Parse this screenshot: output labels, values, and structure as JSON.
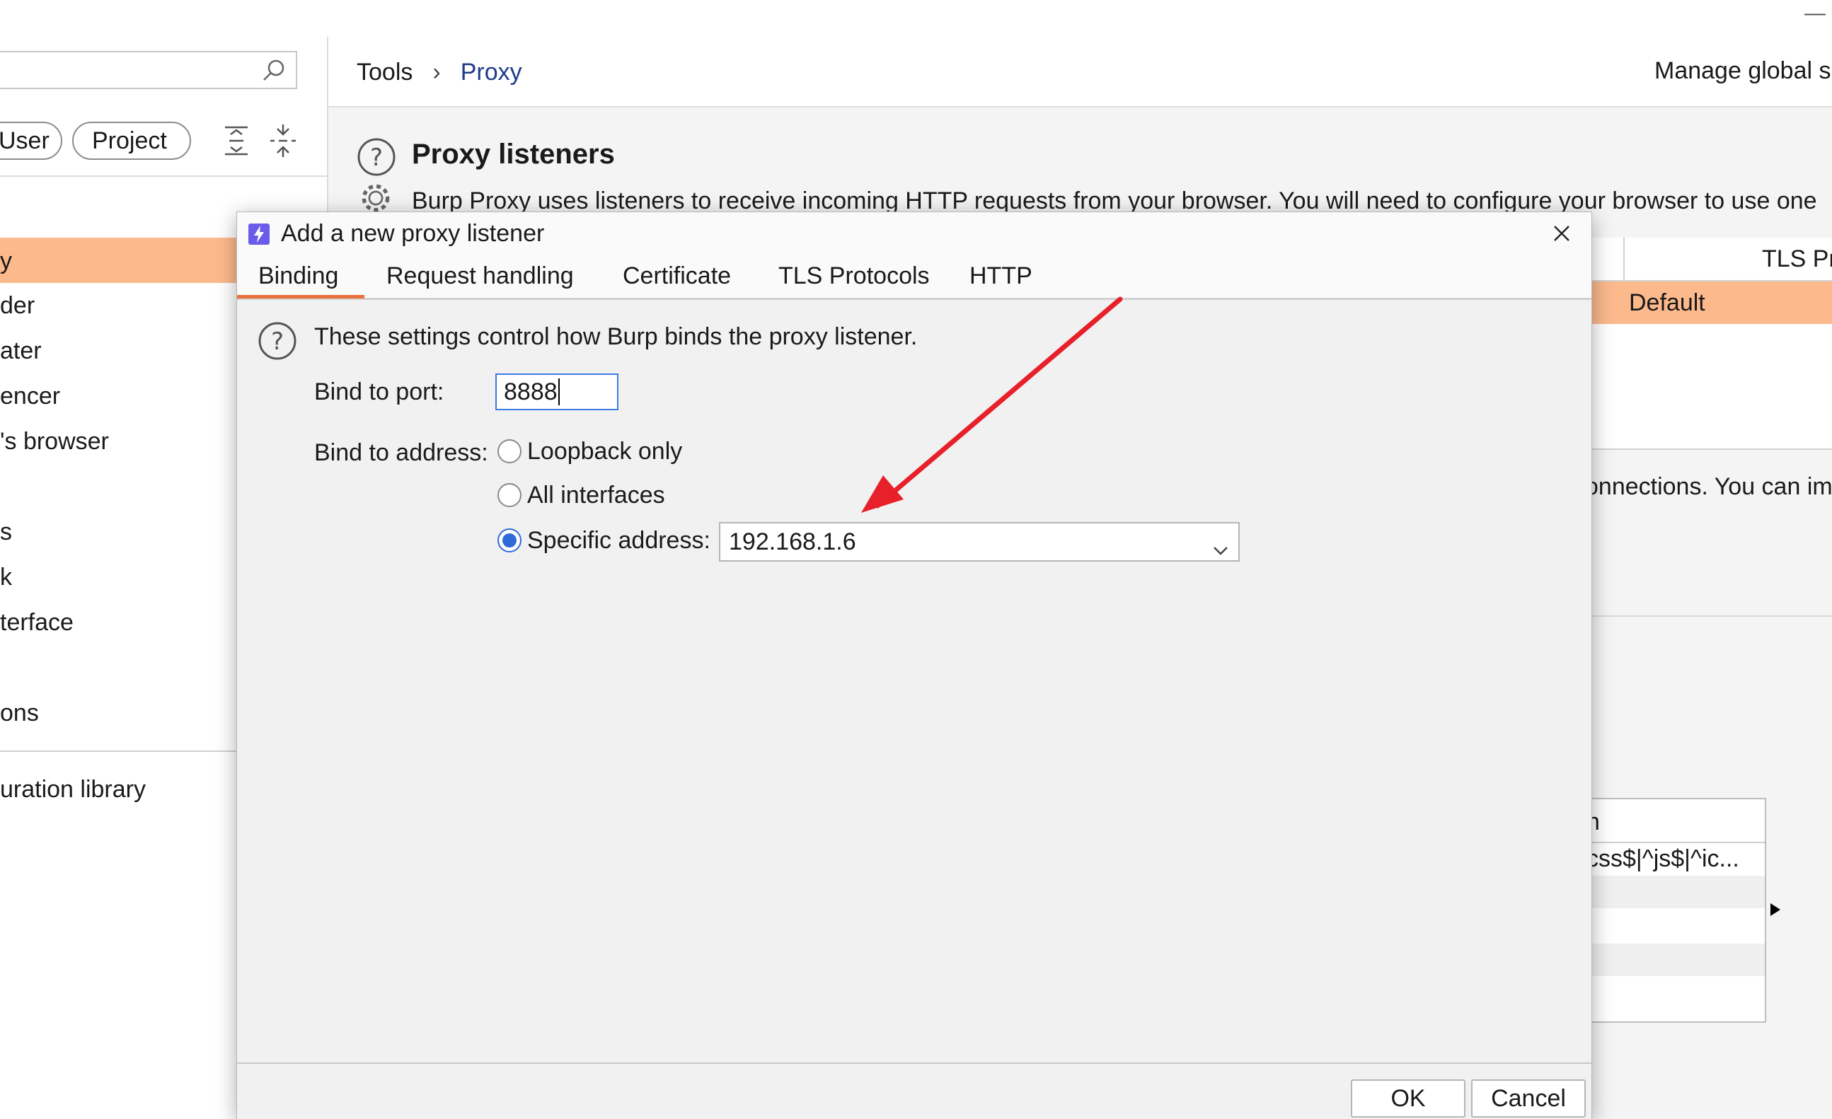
{
  "window": {
    "minimize_glyph": "—"
  },
  "left_panel": {
    "scope_buttons": [
      "User",
      "Project"
    ],
    "nav_items": [
      "y",
      "der",
      "ater",
      "encer",
      "'s browser",
      "s",
      "k",
      "terface",
      "ons"
    ],
    "footer_item": "uration library"
  },
  "breadcrumb": {
    "root": "Tools",
    "separator": "›",
    "current": "Proxy"
  },
  "header_right": {
    "manage_label": "Manage global s"
  },
  "section": {
    "title": "Proxy listeners",
    "description": "Burp Proxy uses listeners to receive incoming HTTP requests from your browser. You will need to configure your browser to use one",
    "second_text": "onnections. You can im"
  },
  "listeners_table": {
    "column_tls": "TLS Pr",
    "row_value": "Default"
  },
  "intercept_table": {
    "header": "n",
    "row_value": "css$|^js$|^ic..."
  },
  "dialog": {
    "title": "Add a new proxy listener",
    "tabs": [
      "Binding",
      "Request handling",
      "Certificate",
      "TLS Protocols",
      "HTTP"
    ],
    "active_tab": "Binding",
    "intro": "These settings control how Burp binds the proxy listener.",
    "port_label": "Bind to port:",
    "port_value": "8888",
    "address_label": "Bind to address:",
    "address_options": [
      "Loopback only",
      "All interfaces",
      "Specific address:"
    ],
    "selected_address_option": "Specific address:",
    "specific_address_value": "192.168.1.6",
    "ok_label": "OK",
    "cancel_label": "Cancel"
  },
  "colors": {
    "accent_orange": "#fcb98c",
    "tab_underline": "#e8703a",
    "focus_blue": "#3d7be0",
    "annotation_arrow": "#e8202a",
    "breadcrumb_link": "#1f3b8a"
  }
}
